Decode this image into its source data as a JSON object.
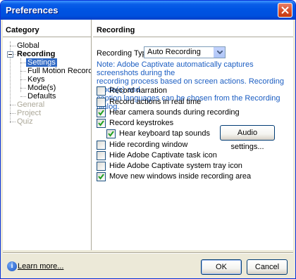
{
  "window": {
    "title": "Preferences"
  },
  "category": {
    "header": "Category",
    "tree": [
      {
        "label": "Global"
      },
      {
        "label": "Recording"
      },
      {
        "label": "Settings"
      },
      {
        "label": "Full Motion Recording"
      },
      {
        "label": "Keys"
      },
      {
        "label": "Mode(s)"
      },
      {
        "label": "Defaults"
      },
      {
        "label": "General"
      },
      {
        "label": "Project"
      },
      {
        "label": "Quiz"
      }
    ]
  },
  "recording": {
    "header": "Recording",
    "type_label": "Recording Type:",
    "type_value": "Auto Recording",
    "note_lines": [
      "Note: Adobe Captivate automatically captures screenshots during the",
      "recording process based on screen actions. Recording mode(s) and",
      "caption languages can be chosen from the Recording dialog."
    ],
    "options": [
      {
        "label": "Record narration",
        "checked": false
      },
      {
        "label": "Record actions in real time",
        "checked": false
      },
      {
        "label": "Hear camera sounds during recording",
        "checked": true
      },
      {
        "label": "Record keystrokes",
        "checked": true
      },
      {
        "label": "Hear keyboard tap sounds",
        "checked": true
      },
      {
        "label": "Hide recording window",
        "checked": false
      },
      {
        "label": "Hide Adobe Captivate task icon",
        "checked": false
      },
      {
        "label": "Hide Adobe Captivate system tray icon",
        "checked": false
      },
      {
        "label": "Move new windows inside recording area",
        "checked": true
      }
    ],
    "audio_settings_label": "Audio settings..."
  },
  "footer": {
    "learn_more": "Learn more...",
    "ok_label": "OK",
    "cancel_label": "Cancel"
  },
  "colors": {
    "titlebar": "#0054e3",
    "selection": "#316ac5",
    "note_text": "#1c5ec2",
    "disabled_text": "#aca899"
  }
}
